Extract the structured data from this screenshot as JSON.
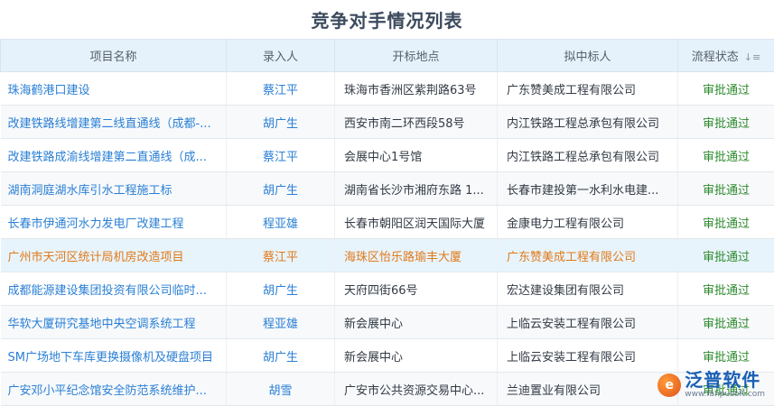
{
  "page": {
    "title": "竞争对手情况列表"
  },
  "table": {
    "columns": [
      "项目名称",
      "录入人",
      "开标地点",
      "拟中标人",
      "流程状态"
    ],
    "sort_icon": "sort-descending-icon",
    "rows": [
      {
        "name": "珠海鹤港口建设",
        "person": "蔡江平",
        "place": "珠海市香洲区紫荆路63号",
        "bidder": "广东赞美成工程有限公司",
        "status": "审批通过"
      },
      {
        "name": "改建铁路线增建第二线直通线（成都-...",
        "person": "胡广生",
        "place": "西安市南二环西段58号",
        "bidder": "内江铁路工程总承包有限公司",
        "status": "审批通过"
      },
      {
        "name": "改建铁路成渝线增建第二直通线（成...",
        "person": "蔡江平",
        "place": "会展中心1号馆",
        "bidder": "内江铁路工程总承包有限公司",
        "status": "审批通过"
      },
      {
        "name": "湖南洞庭湖水库引水工程施工标",
        "person": "胡广生",
        "place": "湖南省长沙市湘府东路 1...",
        "bidder": "长春市建投第一水利水电建...",
        "status": "审批通过"
      },
      {
        "name": "长春市伊通河水力发电厂改建工程",
        "person": "程亚雄",
        "place": "长春市朝阳区润天国际大厦",
        "bidder": "金康电力工程有限公司",
        "status": "审批通过"
      },
      {
        "name": "广州市天河区统计局机房改造项目",
        "person": "蔡江平",
        "place": "海珠区怡乐路瑜丰大厦",
        "bidder": "广东赞美成工程有限公司",
        "status": "审批通过"
      },
      {
        "name": "成都能源建设集团投资有限公司临时...",
        "person": "胡广生",
        "place": "天府四街66号",
        "bidder": "宏达建设集团有限公司",
        "status": "审批通过"
      },
      {
        "name": "华软大厦研究基地中央空调系统工程",
        "person": "程亚雄",
        "place": "新会展中心",
        "bidder": "上临云安装工程有限公司",
        "status": "审批通过"
      },
      {
        "name": "SM广场地下车库更换摄像机及硬盘项目",
        "person": "胡广生",
        "place": "新会展中心",
        "bidder": "上临云安装工程有限公司",
        "status": "审批通过"
      },
      {
        "name": "广安邓小平纪念馆安全防范系统维护...",
        "person": "胡雪",
        "place": "广安市公共资源交易中心...",
        "bidder": "兰迪置业有限公司",
        "status": "审批通过"
      }
    ]
  },
  "watermark": {
    "name": "泛普软件",
    "url": "www.fanpusoft.com"
  },
  "colors": {
    "link": "#2a7fd4",
    "status_ok": "#2d8a2d",
    "selected_text": "#e07a1a",
    "header_bg": "#e6f2fb"
  }
}
